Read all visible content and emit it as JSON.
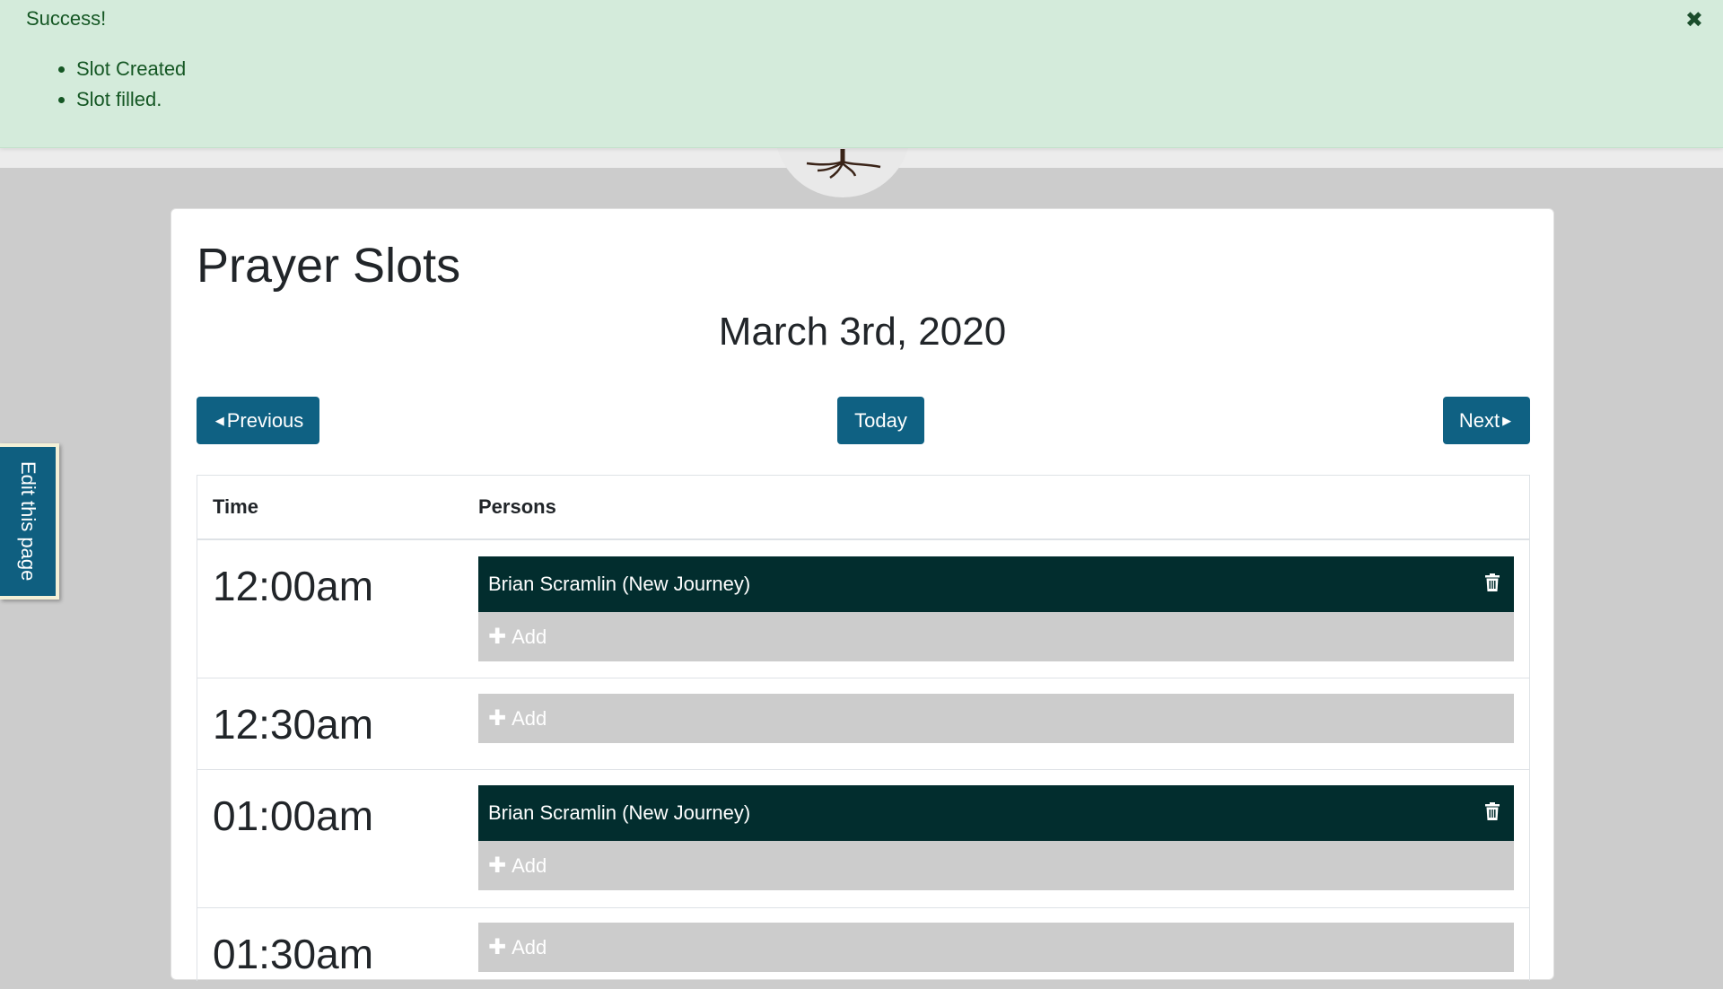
{
  "alert": {
    "title": "Success!",
    "messages": [
      "Slot Created",
      "Slot filled."
    ],
    "close_glyph": "✖"
  },
  "edit_tab": {
    "label": "Edit this page"
  },
  "page": {
    "title": "Prayer Slots",
    "date": "March 3rd, 2020"
  },
  "nav": {
    "previous_label": "Previous",
    "today_label": "Today",
    "next_label": "Next"
  },
  "table": {
    "headers": {
      "time": "Time",
      "persons": "Persons"
    },
    "add_label": "Add",
    "rows": [
      {
        "time": "12:00am",
        "persons": [
          "Brian Scramlin (New Journey)"
        ]
      },
      {
        "time": "12:30am",
        "persons": []
      },
      {
        "time": "01:00am",
        "persons": [
          "Brian Scramlin (New Journey)"
        ]
      },
      {
        "time": "01:30am",
        "persons": []
      }
    ]
  },
  "colors": {
    "primary_button": "#0f6183",
    "filled_slot": "#022d2e",
    "alert_bg": "#d4ebdb",
    "alert_text": "#155724"
  },
  "icons": [
    "close-icon",
    "caret-left-icon",
    "caret-right-icon",
    "trash-icon",
    "plus-icon",
    "tree-logo-icon"
  ]
}
